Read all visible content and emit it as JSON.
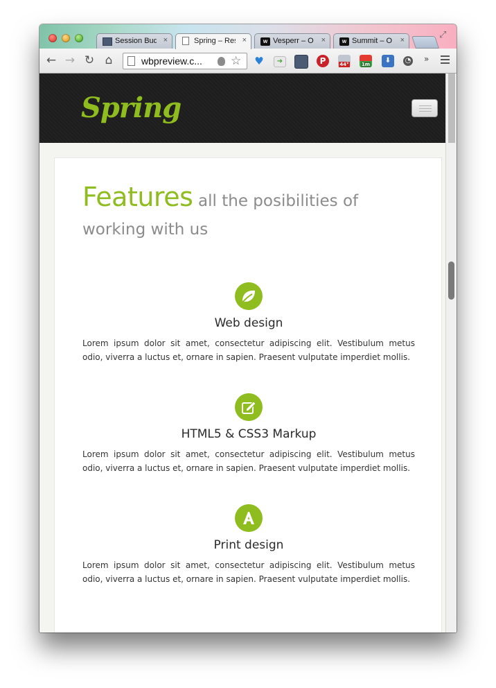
{
  "browser": {
    "tabs": [
      {
        "label": "Session Buddy",
        "favicon": "session-buddy-icon",
        "active": false
      },
      {
        "label": "Spring – Responsive",
        "favicon": "page-icon",
        "active": true
      },
      {
        "label": "Vesperr – O",
        "favicon": "wordpress-w-icon",
        "active": false
      },
      {
        "label": "Summit – O",
        "favicon": "wordpress-w-icon",
        "active": false
      }
    ],
    "tab_close_glyph": "×",
    "url": "wbpreview.c...",
    "extension_badges": {
      "badge_a": "44°",
      "badge_b": "1m"
    },
    "overflow_glyph": "»"
  },
  "site": {
    "logo": "Spring",
    "brand_color": "#8fbc1f"
  },
  "features": {
    "title": "Features",
    "subtitle": "all the posibilities of working with us",
    "items": [
      {
        "icon": "leaf-icon",
        "title": "Web design",
        "text": "Lorem ipsum dolor sit amet, consectetur adipiscing elit. Vestibulum metus odio, viverra a luctus et, ornare in sapien. Praesent vulputate imperdiet mollis."
      },
      {
        "icon": "edit-icon",
        "title": "HTML5 & CSS3 Markup",
        "text": "Lorem ipsum dolor sit amet, consectetur adipiscing elit. Vestibulum metus odio, viverra a luctus et, ornare in sapien. Praesent vulputate imperdiet mollis."
      },
      {
        "icon": "font-a-icon",
        "title": "Print design",
        "text": "Lorem ipsum dolor sit amet, consectetur adipiscing elit. Vestibulum metus odio, viverra a luctus et, ornare in sapien. Praesent vulputate imperdiet mollis."
      }
    ]
  }
}
